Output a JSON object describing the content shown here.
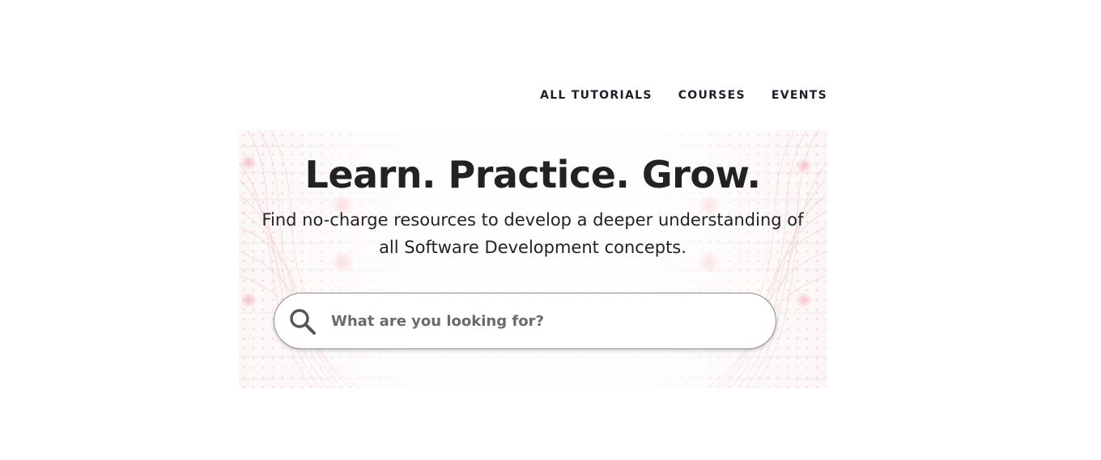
{
  "nav": {
    "items": [
      {
        "label": "ALL TUTORIALS"
      },
      {
        "label": "COURSES"
      },
      {
        "label": "EVENTS"
      }
    ]
  },
  "hero": {
    "title": "Learn. Practice. Grow.",
    "subtitle_line1": "Find no-charge resources to develop a deeper understanding of",
    "subtitle_line2": "all Software Development concepts."
  },
  "search": {
    "placeholder": "What are you looking for?",
    "value": "",
    "icon": "search-icon"
  },
  "colors": {
    "text": "#222222",
    "nav_text": "#1f1f2b",
    "accent_pattern": "#e8a0a8",
    "search_border": "#8f8f8f"
  }
}
